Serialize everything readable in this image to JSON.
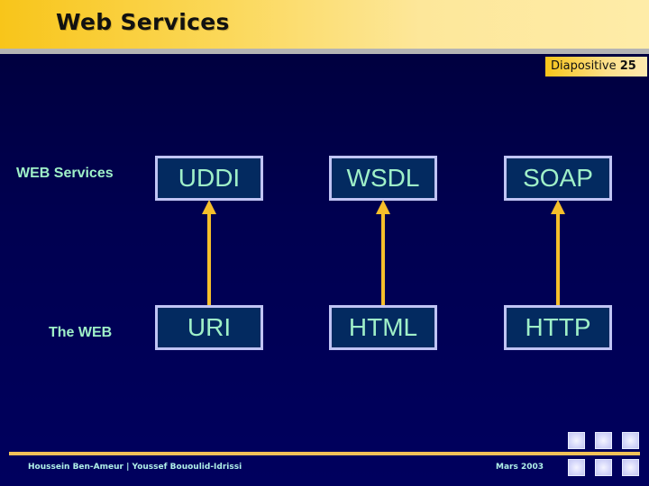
{
  "header": {
    "title": "Web Services"
  },
  "slide_badge": {
    "label": "Diapositive",
    "number": "25"
  },
  "rows": [
    {
      "label": "WEB Services",
      "items": [
        "UDDI",
        "WSDL",
        "SOAP"
      ]
    },
    {
      "label": "The WEB",
      "items": [
        "URI",
        "HTML",
        "HTTP"
      ]
    }
  ],
  "footer": {
    "authors": "Houssein Ben-Ameur | Youssef Bououlid-Idrissi",
    "date": "Mars 2003"
  },
  "nav_buttons": [
    "nav-button-1",
    "nav-button-2",
    "nav-button-3",
    "nav-button-4",
    "nav-button-5",
    "nav-button-6"
  ],
  "colors": {
    "background": "#000050",
    "header_gold": "#f8c51a",
    "box_fill": "#032a60",
    "box_border": "#c0c4f4",
    "text_mint": "#9ff0c8",
    "arrow": "#f6bf2a"
  }
}
